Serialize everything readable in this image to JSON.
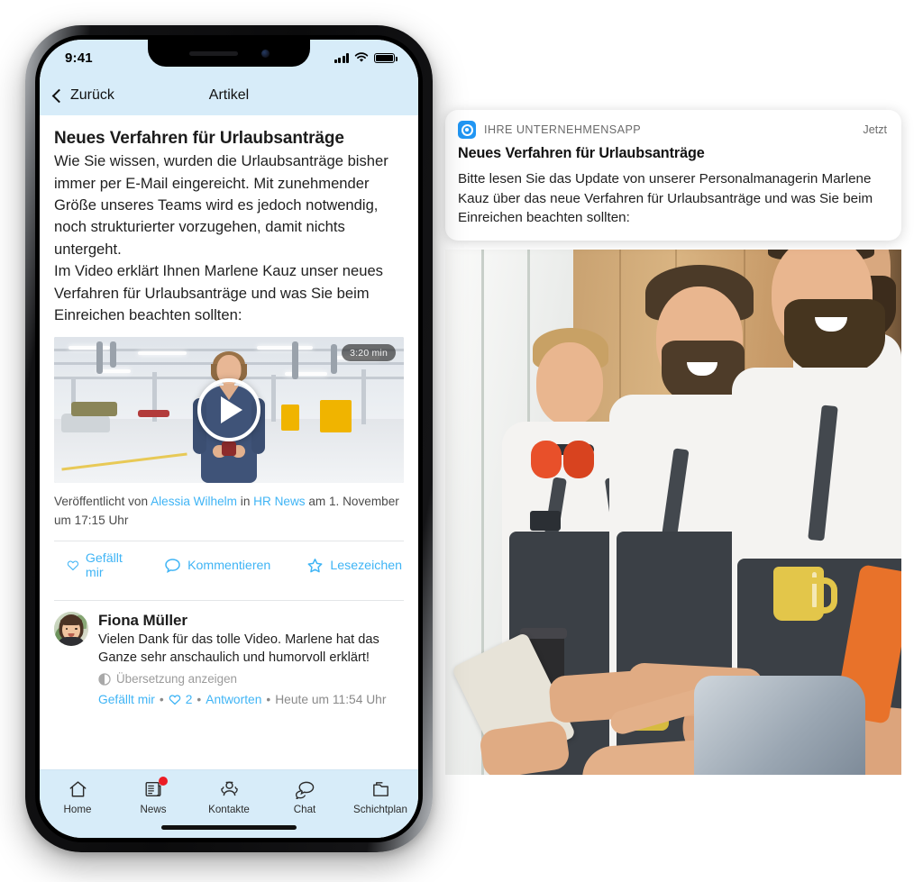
{
  "phone": {
    "status_bar": {
      "time": "9:41",
      "signal_icon": "cellular-bars-icon",
      "wifi_icon": "wifi-icon",
      "battery_icon": "battery-icon"
    },
    "nav": {
      "back_label": "Zurück",
      "title": "Artikel",
      "back_icon": "chevron-left-icon"
    },
    "article": {
      "title": "Neues Verfahren für Urlaubsanträge",
      "body": "Wie Sie wissen, wurden die Urlaubsanträge bisher immer per E-Mail eingereicht. Mit zunehmender Größe unseres Teams wird es jedoch notwendig, noch strukturierter vorzugehen, damit nichts untergeht.\nIm Video erklärt Ihnen Marlene Kauz unser neues Verfahren für Urlaubsanträge und was Sie beim Einreichen beachten sollten:",
      "video": {
        "duration": "3:20 min",
        "play_icon": "play-icon",
        "alt": "Frau in Fabrikhalle"
      },
      "byline": {
        "prefix": "Veröffentlicht von ",
        "author": "Alessia Wilhelm",
        "middle": " in ",
        "channel": "HR News",
        "suffix": " am 1. November um 17:15 Uhr"
      },
      "actions": [
        {
          "label": "Gefällt mir",
          "icon": "heart-icon"
        },
        {
          "label": "Kommentieren",
          "icon": "comment-bubble-icon"
        },
        {
          "label": "Lesezeichen",
          "icon": "star-icon"
        }
      ]
    },
    "comment": {
      "author": "Fiona Müller",
      "avatar_icon": "user-avatar",
      "text": "Vielen Dank für das tolle Video. Marlene hat das Ganze sehr anschaulich und humorvoll erklärt!",
      "translate_label": "Übersetzung anzeigen",
      "translate_icon": "globe-icon",
      "like_label": "Gefällt mir",
      "like_count": "2",
      "like_count_icon": "heart-outline-icon",
      "reply_label": "Antworten",
      "timestamp": "Heute um 11:54 Uhr",
      "separator": "•"
    },
    "tabbar": [
      {
        "label": "Home",
        "icon": "home-icon",
        "badge": false
      },
      {
        "label": "News",
        "icon": "newspaper-icon",
        "badge": true
      },
      {
        "label": "Kontakte",
        "icon": "contacts-icon",
        "badge": false
      },
      {
        "label": "Chat",
        "icon": "chat-bubbles-icon",
        "badge": false
      },
      {
        "label": "Schichtplan",
        "icon": "folder-icon",
        "badge": false
      }
    ]
  },
  "notification": {
    "app_icon": "app-target-icon",
    "app_name": "IHRE UNTERNEHMENSAPP",
    "time": "Jetzt",
    "title": "Neues Verfahren für Urlaubsanträge",
    "text": "Bitte lesen Sie das Update von unserer Personalmanagerin Marlene Kauz über das neue Verfahren für Urlaubsanträge und was Sie beim Einreichen beachten sollten:"
  },
  "photo": {
    "alt": "Drei lachende Arbeiter in weißen T-Shirts und Latzhosen mit Smartphone und Kaffeebechern"
  },
  "colors": {
    "accent": "#3fb4f5",
    "header_bg": "#d7ecf9",
    "badge_red": "#ec1c24",
    "app_icon_blue": "#2196f3"
  }
}
